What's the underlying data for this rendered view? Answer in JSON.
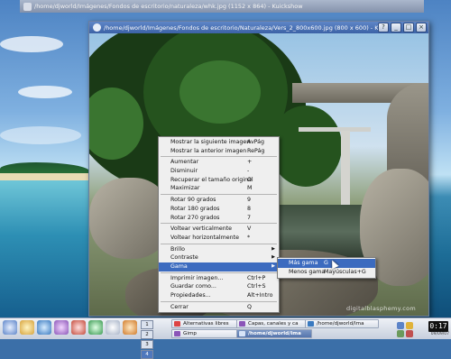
{
  "background_window": {
    "title": "/home/djworld/Imágenes/Fondos de escritorio/naturaleza/whk.jpg (1152 x 864) - Kuickshow"
  },
  "main_window": {
    "title": "/home/djworld/Imágenes/Fondos de escritorio/Naturaleza/Vers_2_800x600.jpg (800 x 600) - Kuickshow",
    "buttons": [
      "?",
      "_",
      "□",
      "×"
    ],
    "watermark": "digitalblasphemy.com"
  },
  "context_menu": {
    "items": [
      {
        "label": "Mostrar la siguiente imagen",
        "shortcut": "AvPág"
      },
      {
        "label": "Mostrar la anterior imagen",
        "shortcut": "RePág"
      },
      {
        "sep": true
      },
      {
        "label": "Aumentar",
        "shortcut": "+"
      },
      {
        "label": "Disminuir",
        "shortcut": "-"
      },
      {
        "label": "Recuperar el tamaño original",
        "shortcut": "O"
      },
      {
        "label": "Maximizar",
        "shortcut": "M"
      },
      {
        "sep": true
      },
      {
        "label": "Rotar 90 grados",
        "shortcut": "9"
      },
      {
        "label": "Rotar 180 grados",
        "shortcut": "8"
      },
      {
        "label": "Rotar 270 grados",
        "shortcut": "7"
      },
      {
        "sep": true
      },
      {
        "label": "Voltear verticalmente",
        "shortcut": "V"
      },
      {
        "label": "Voltear horizontalmente",
        "shortcut": "*"
      },
      {
        "sep": true
      },
      {
        "label": "Brillo",
        "shortcut": "",
        "submenu": true
      },
      {
        "label": "Contraste",
        "shortcut": "",
        "submenu": true
      },
      {
        "label": "Gama",
        "shortcut": "",
        "submenu": true,
        "active": true
      },
      {
        "sep": true
      },
      {
        "label": "Imprimir imagen...",
        "shortcut": "Ctrl+P"
      },
      {
        "label": "Guardar como...",
        "shortcut": "Ctrl+S"
      },
      {
        "label": "Propiedades...",
        "shortcut": "Alt+Intro"
      },
      {
        "sep": true
      },
      {
        "label": "Cerrar",
        "shortcut": "Q"
      }
    ]
  },
  "gamma_submenu": {
    "items": [
      {
        "label": "Más gama",
        "shortcut": "G",
        "active": true
      },
      {
        "label": "Menos gama",
        "shortcut": "Mayúsculas+G"
      }
    ]
  },
  "taskbar": {
    "pager": [
      "1",
      "2",
      "3",
      "4"
    ],
    "active_desktop": "4",
    "tasks": [
      {
        "label": "Alternativas libres"
      },
      {
        "label": "Capas, canales y ca"
      },
      {
        "label": "/home/djworld/Ima"
      },
      {
        "label": "Gimp"
      },
      {
        "label": "/home/djworld/Ima"
      }
    ],
    "clock": "0:17",
    "date": "09/09/07"
  }
}
